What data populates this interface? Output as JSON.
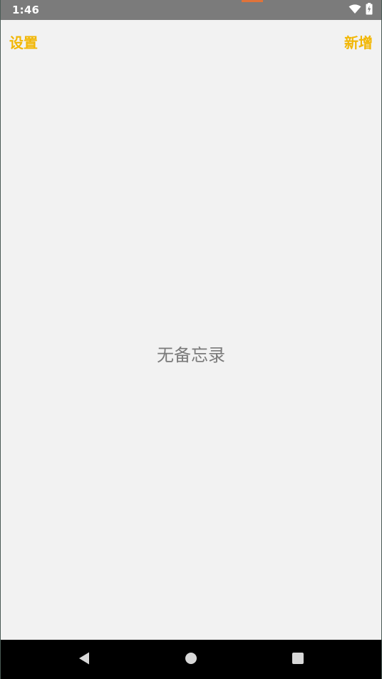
{
  "status_bar": {
    "time": "1:46",
    "icons": [
      "wifi-icon",
      "battery-charging-icon"
    ]
  },
  "header": {
    "left_button_label": "设置",
    "right_button_label": "新增"
  },
  "main": {
    "empty_message": "无备忘录"
  },
  "nav_bar": {
    "icons": [
      "back-icon",
      "home-icon",
      "recents-icon"
    ]
  },
  "colors": {
    "accent": "#f2b705",
    "status_bar": "#7b7b7b",
    "background": "#f2f2f2",
    "empty_text": "#7a7a7a",
    "nav_bar": "#000000"
  }
}
